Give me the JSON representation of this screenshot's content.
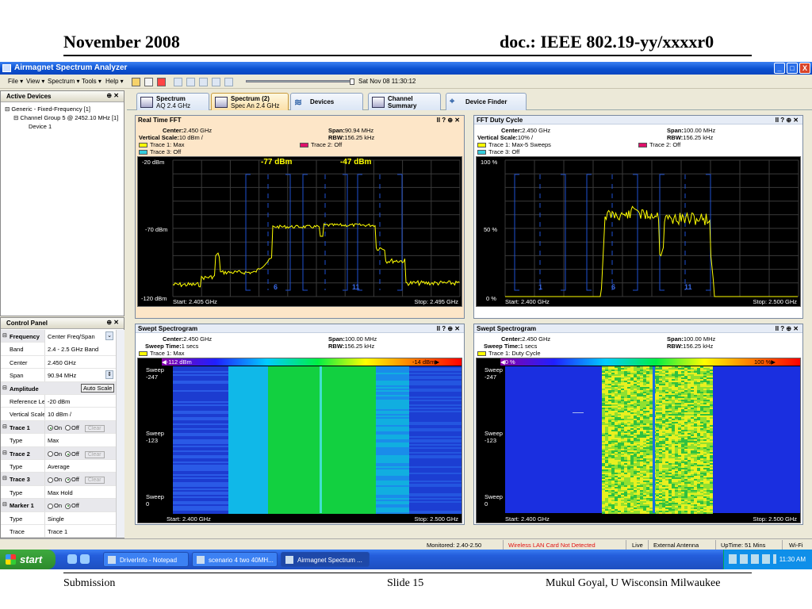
{
  "slide": {
    "date": "November 2008",
    "doc": "doc.: IEEE 802.19-yy/xxxxr0",
    "submission": "Submission",
    "slide_no": "Slide 15",
    "author": "Mukul Goyal, U Wisconsin Milwaukee"
  },
  "window": {
    "title": "Airmagnet Spectrum Analyzer",
    "buttons": [
      "_",
      "□",
      "X"
    ]
  },
  "menu": {
    "items": [
      "File ▾",
      "View ▾",
      "Spectrum ▾",
      "Tools ▾",
      "Help ▾"
    ],
    "datetime": "Sat Nov 08 11:30:12"
  },
  "active_devices": {
    "title": "Active Devices",
    "pin": "⊕ ✕",
    "tree": [
      "⊟ Generic - Fixed-Frequency [1]",
      "⊟ Channel Group 5 @ 2452.10 MHz [1]",
      "Device 1"
    ]
  },
  "control_panel": {
    "title": "Control Panel",
    "pin": "⊕ ✕",
    "rows": [
      {
        "type": "section",
        "key": "Frequency",
        "value": "Center Freq/Span"
      },
      {
        "type": "row",
        "key": "Band",
        "value": "2.4 - 2.5 GHz Band"
      },
      {
        "type": "row",
        "key": "Center",
        "value": "2.450 GHz"
      },
      {
        "type": "row",
        "key": "Span",
        "value": "90.94 MHz"
      },
      {
        "type": "section",
        "key": "Amplitude",
        "value": "Auto Scale"
      },
      {
        "type": "row",
        "key": "Reference Le",
        "value": "-20 dBm"
      },
      {
        "type": "row",
        "key": "Vertical Scale",
        "value": "10 dBm /"
      },
      {
        "type": "section",
        "key": "Trace 1",
        "on": true
      },
      {
        "type": "row",
        "key": "Type",
        "value": "Max"
      },
      {
        "type": "section",
        "key": "Trace 2",
        "on": false
      },
      {
        "type": "row",
        "key": "Type",
        "value": "Average"
      },
      {
        "type": "section",
        "key": "Trace 3",
        "on": false
      },
      {
        "type": "row",
        "key": "Type",
        "value": "Max Hold"
      },
      {
        "type": "section",
        "key": "Marker 1",
        "on": false,
        "noclear": true
      },
      {
        "type": "row",
        "key": "Type",
        "value": "Single"
      },
      {
        "type": "row",
        "key": "Trace",
        "value": "Trace 1"
      }
    ],
    "on_label": "On",
    "off_label": "Off",
    "clear_label": "Clear"
  },
  "tabs": [
    {
      "l1": "Spectrum",
      "l2": "AQ 2.4 GHz",
      "active": false
    },
    {
      "l1": "Spectrum (2)",
      "l2": "Spec An 2.4 GHz",
      "active": true
    },
    {
      "l1": "Devices",
      "l2": "",
      "active": false
    },
    {
      "l1": "Channel",
      "l2": "Summary",
      "active": false
    },
    {
      "l1": "Device Finder",
      "l2": "",
      "active": false
    }
  ],
  "views": {
    "fft": {
      "title": "Real Time FFT",
      "controls": "II ? ⊕ ✕",
      "center": "2.450 GHz",
      "span": "90.94 MHz",
      "vscale": "10 dBm /",
      "rbw": "156.25 kHz",
      "trace1": "Trace 1: Max",
      "trace2": "Trace 2: Off",
      "trace3": "Trace 3: Off",
      "ytop": "-20 dBm",
      "ymid": "-70 dBm",
      "ybot": "-120 dBm",
      "marker1": "-77 dBm",
      "marker2": "-47 dBm",
      "ch1": "6",
      "ch2": "11",
      "start": "Start: 2.405 GHz",
      "stop": "Stop: 2.495 GHz"
    },
    "duty": {
      "title": "FFT Duty Cycle",
      "controls": "II ? ⊕ ✕",
      "center": "2.450 GHz",
      "span": "100.00 MHz",
      "vscale": "10% /",
      "rbw": "156.25 kHz",
      "trace1": "Trace 1: Max-5 Sweeps",
      "trace2": "Trace 2: Off",
      "trace3": "Trace 3: Off",
      "ytop": "100 %",
      "ymid": "50 %",
      "ybot": "0 %",
      "ch0": "1",
      "ch1": "6",
      "ch2": "11",
      "start": "Start: 2.400 GHz",
      "stop": "Stop: 2.500 GHz"
    },
    "spec1": {
      "title": "Swept Spectrogram",
      "controls": "II ? ⊕ ✕",
      "center": "2.450 GHz",
      "span": "100.00 MHz",
      "sweep_time": "1 secs",
      "rbw": "156.25 kHz",
      "trace1": "Trace 1: Max",
      "scale_lo": "◀-112 dBm",
      "scale_hi": "-14 dBm▶",
      "s1": "Sweep\n-247",
      "s2": "Sweep\n-123",
      "s3": "Sweep\n0",
      "start": "Start: 2.400 GHz",
      "stop": "Stop: 2.500 GHz"
    },
    "spec2": {
      "title": "Swept Spectrogram",
      "controls": "II ? ⊕ ✕",
      "center": "2.450 GHz",
      "span": "100.00 MHz",
      "sweep_time": "1 secs",
      "rbw": "156.25 kHz",
      "trace1": "Trace 1: Duty Cycle",
      "scale_lo": "◀0 %",
      "scale_hi": "100 %▶",
      "s1": "Sweep\n-247",
      "s2": "Sweep\n-123",
      "s3": "Sweep\n0",
      "start": "Start: 2.400 GHz",
      "stop": "Stop: 2.500 GHz"
    },
    "labels": {
      "center": "Center:",
      "span": "Span:",
      "vscale": "Vertical Scale:",
      "rbw": "RBW:",
      "sweep_time": "Sweep Time:"
    }
  },
  "status": {
    "monitored": "Monitored: 2.40-2.50",
    "warning": "Wireless LAN Card Not Detected",
    "live": "Live",
    "antenna": "External Antenna",
    "uptime": "UpTime: 51 Mins",
    "wifi": "Wi-Fi"
  },
  "taskbar": {
    "start": "start",
    "tasks": [
      "DriverInfo - Notepad",
      "scenario 4 two 40MH...",
      "Airmagnet Spectrum ..."
    ],
    "clock": "11:30 AM"
  },
  "colors": {
    "trace_yellow": "#ffff00",
    "trace_magenta": "#e0106a",
    "trace_cyan": "#33ccdd",
    "channel_blue": "#1e50d0",
    "warning_red": "#e01010"
  }
}
